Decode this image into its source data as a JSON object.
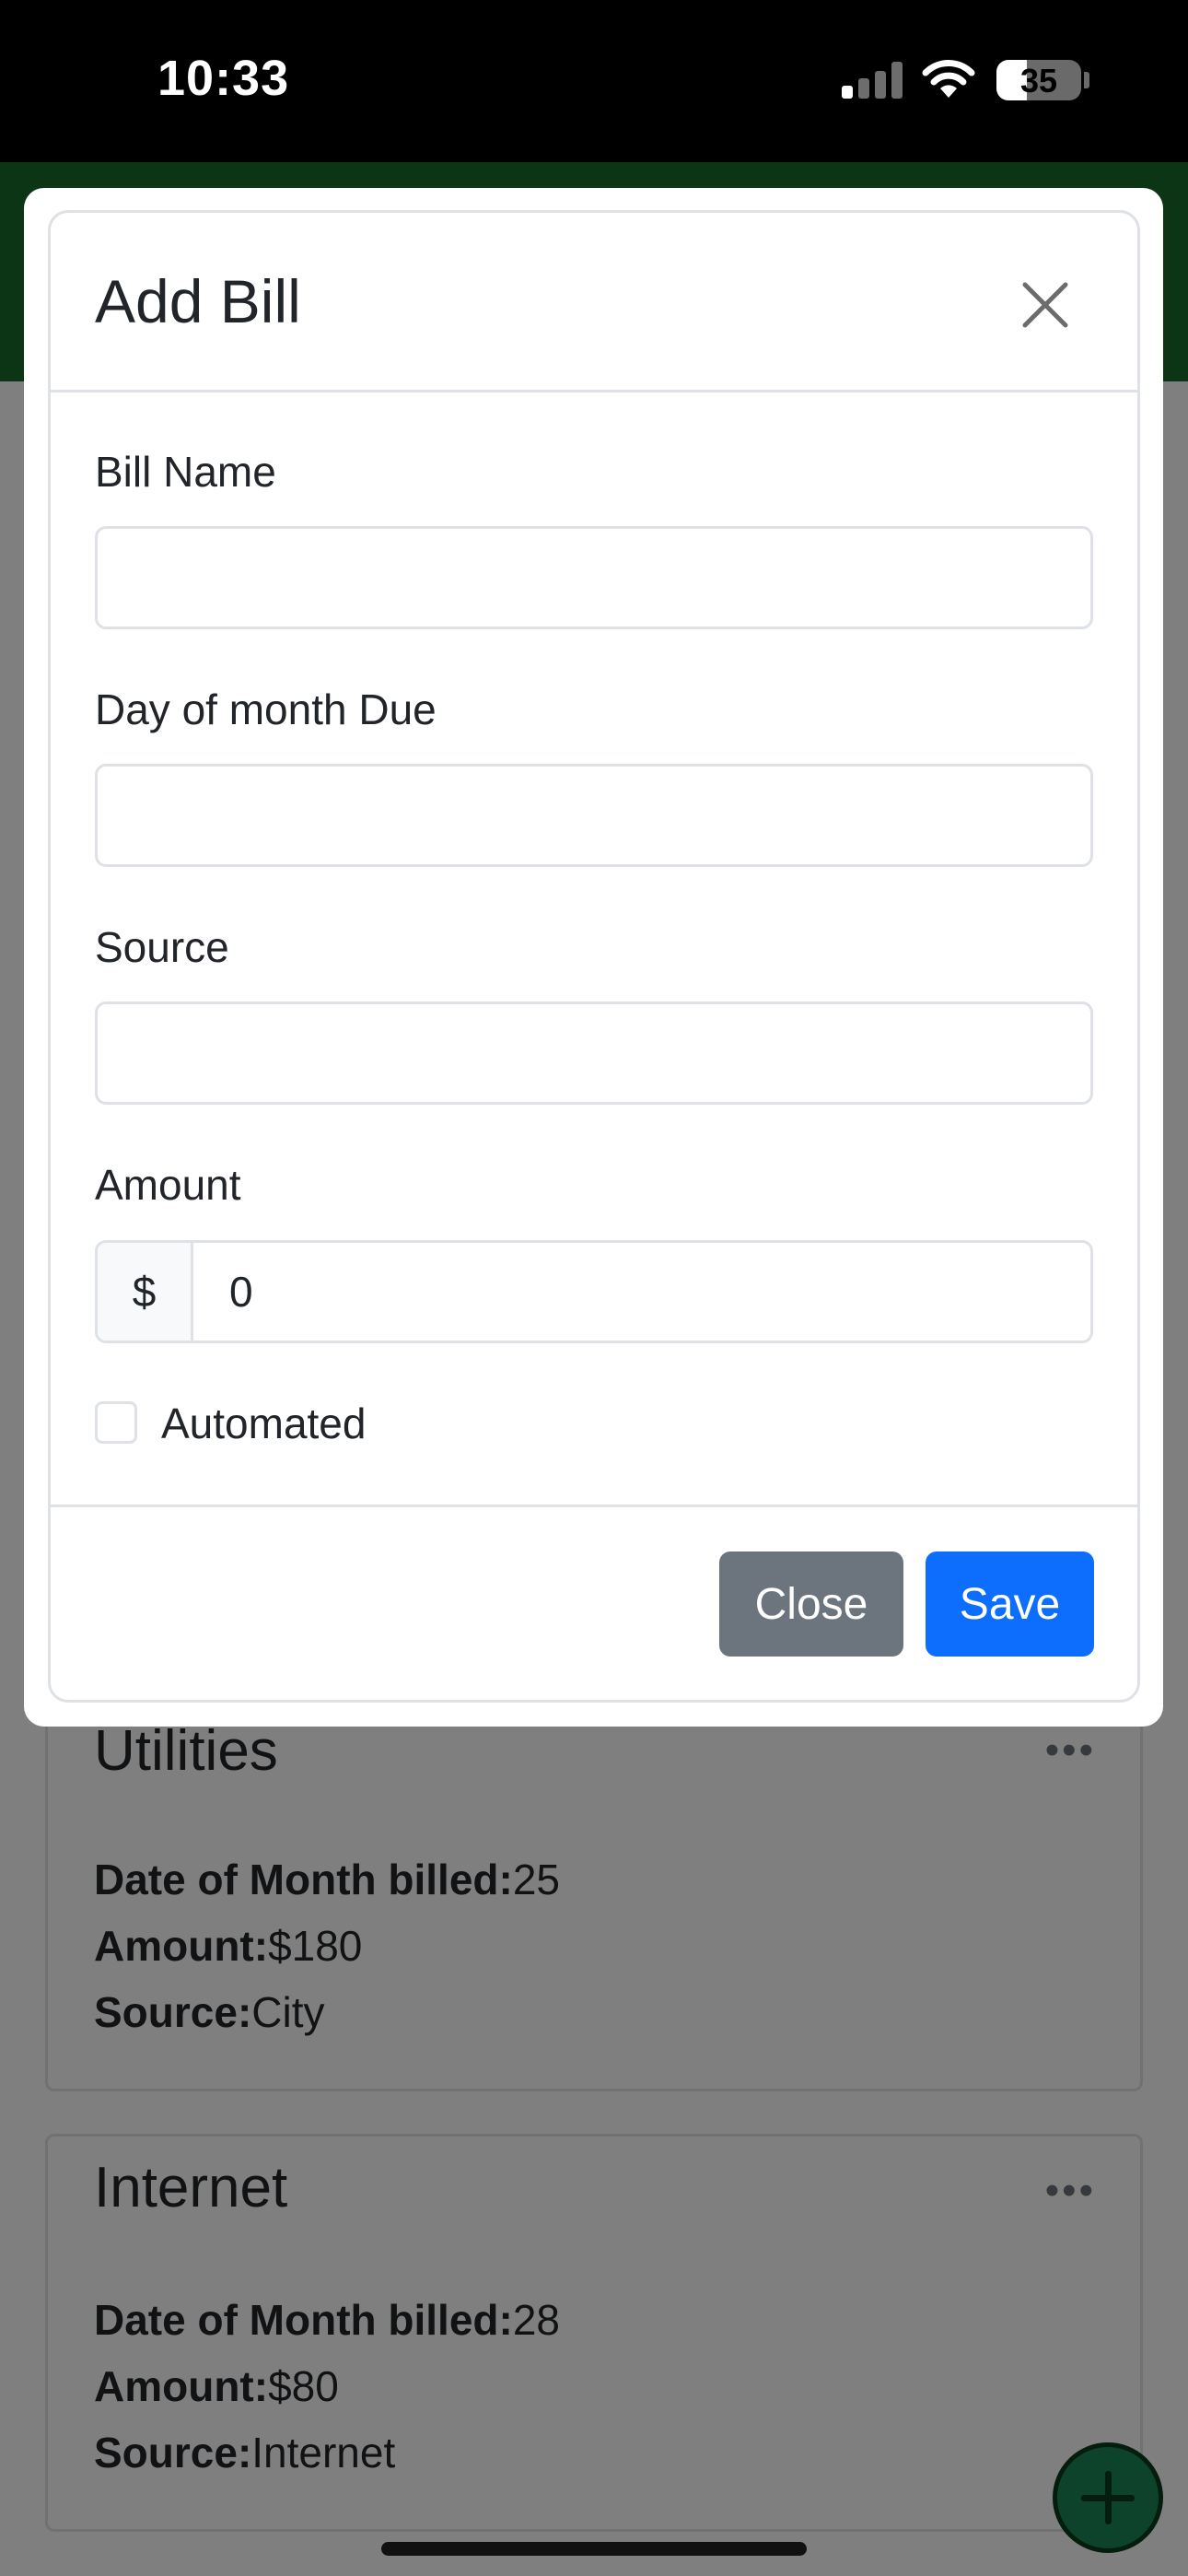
{
  "status_bar": {
    "time": "10:33",
    "battery": "35",
    "battery_fraction": 0.35
  },
  "background": {
    "cards": [
      {
        "title": "Utilities",
        "more_icon": "ellipsis-icon",
        "date_label": "Date of Month billed:",
        "date_value": "25",
        "amount_label": "Amount:",
        "amount_value": "$180",
        "source_label": "Source:",
        "source_value": "City"
      },
      {
        "title": "Internet",
        "more_icon": "ellipsis-icon",
        "date_label": "Date of Month billed:",
        "date_value": "28",
        "amount_label": "Amount:",
        "amount_value": "$80",
        "source_label": "Source:",
        "source_value": "Internet"
      }
    ],
    "fab_icon": "plus-icon",
    "header_color": "#166b2a"
  },
  "modal": {
    "title": "Add Bill",
    "close_icon": "close-icon",
    "fields": {
      "bill_name": {
        "label": "Bill Name",
        "value": ""
      },
      "day_due": {
        "label": "Day of month Due",
        "value": ""
      },
      "source": {
        "label": "Source",
        "value": ""
      },
      "amount": {
        "label": "Amount",
        "prefix": "$",
        "value": "0"
      }
    },
    "automated": {
      "label": "Automated",
      "checked": false
    },
    "buttons": {
      "close": "Close",
      "save": "Save"
    },
    "colors": {
      "close_button": "#6c757d",
      "save_button": "#0d6efd"
    }
  }
}
